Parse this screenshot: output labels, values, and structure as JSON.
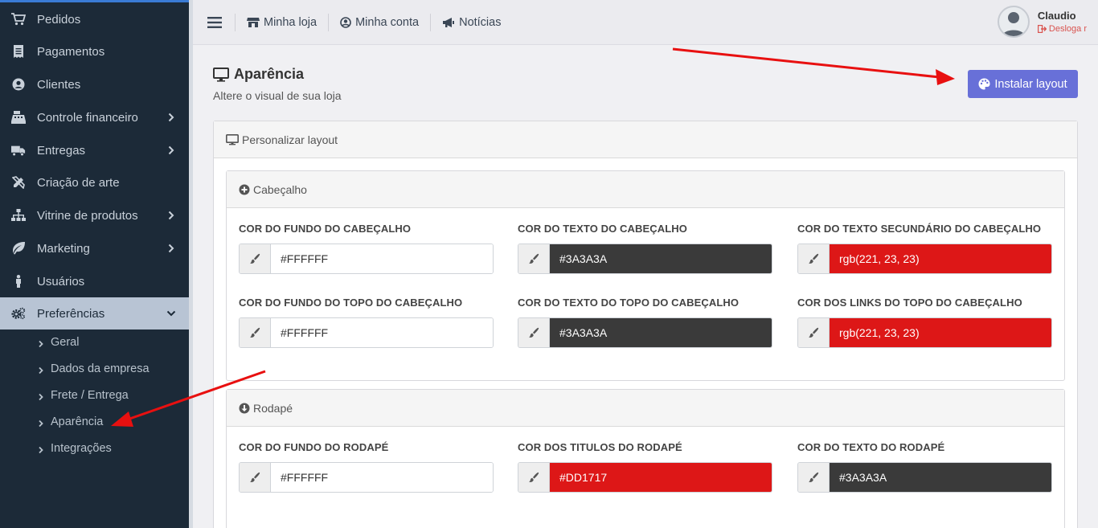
{
  "sidebar": {
    "items": [
      {
        "label": "Pedidos",
        "icon": "cart-icon",
        "has_sub": false
      },
      {
        "label": "Pagamentos",
        "icon": "receipt-icon",
        "has_sub": false
      },
      {
        "label": "Clientes",
        "icon": "user-circle-icon",
        "has_sub": false
      },
      {
        "label": "Controle financeiro",
        "icon": "cash-register-icon",
        "has_sub": true
      },
      {
        "label": "Entregas",
        "icon": "truck-icon",
        "has_sub": true
      },
      {
        "label": "Criação de arte",
        "icon": "pencil-ruler-icon",
        "has_sub": false
      },
      {
        "label": "Vitrine de produtos",
        "icon": "sitemap-icon",
        "has_sub": true
      },
      {
        "label": "Marketing",
        "icon": "leaf-icon",
        "has_sub": true
      },
      {
        "label": "Usuários",
        "icon": "person-icon",
        "has_sub": false
      },
      {
        "label": "Preferências",
        "icon": "cogs-icon",
        "has_sub": true,
        "active": true
      }
    ],
    "submenu": [
      "Geral",
      "Dados da empresa",
      "Frete / Entrega",
      "Aparência",
      "Integrações"
    ]
  },
  "topbar": {
    "links": [
      "Minha loja",
      "Minha conta",
      "Notícias"
    ],
    "user_name": "Claudio",
    "logout_label": "Desloga r"
  },
  "page": {
    "title": "Aparência",
    "subtitle": "Altere o visual de sua loja",
    "install_button": "Instalar layout",
    "card_title": "Personalizar layout"
  },
  "header_panel": {
    "title": "Cabeçalho",
    "fields": [
      {
        "label": "COR DO FUNDO DO CABEÇALHO",
        "value": "#FFFFFF",
        "bg": "#FFFFFF",
        "fg": "#333333"
      },
      {
        "label": "COR DO TEXTO DO CABEÇALHO",
        "value": "#3A3A3A",
        "bg": "#3A3A3A",
        "fg": "#FFFFFF"
      },
      {
        "label": "COR DO TEXTO SECUNDÁRIO DO CABEÇALHO",
        "value": "rgb(221, 23, 23)",
        "bg": "#DD1717",
        "fg": "#FFFFFF"
      },
      {
        "label": "COR DO FUNDO DO TOPO DO CABEÇALHO",
        "value": "#FFFFFF",
        "bg": "#FFFFFF",
        "fg": "#333333"
      },
      {
        "label": "COR DO TEXTO DO TOPO DO CABEÇALHO",
        "value": "#3A3A3A",
        "bg": "#3A3A3A",
        "fg": "#FFFFFF"
      },
      {
        "label": "COR DOS LINKS DO TOPO DO CABEÇALHO",
        "value": "rgb(221, 23, 23)",
        "bg": "#DD1717",
        "fg": "#FFFFFF"
      }
    ]
  },
  "footer_panel": {
    "title": "Rodapé",
    "fields": [
      {
        "label": "COR DO FUNDO DO RODAPÉ",
        "value": "#FFFFFF",
        "bg": "#FFFFFF",
        "fg": "#333333"
      },
      {
        "label": "COR DOS TITULOS DO RODAPÉ",
        "value": "#DD1717",
        "bg": "#DD1717",
        "fg": "#FFFFFF"
      },
      {
        "label": "COR DO TEXTO DO RODAPÉ",
        "value": "#3A3A3A",
        "bg": "#3A3A3A",
        "fg": "#FFFFFF"
      }
    ]
  },
  "colors": {
    "sidebar_bg": "#1C2A38",
    "accent_button": "#6870D8",
    "annotation_arrow": "#E81010",
    "logout": "#D9534F"
  }
}
